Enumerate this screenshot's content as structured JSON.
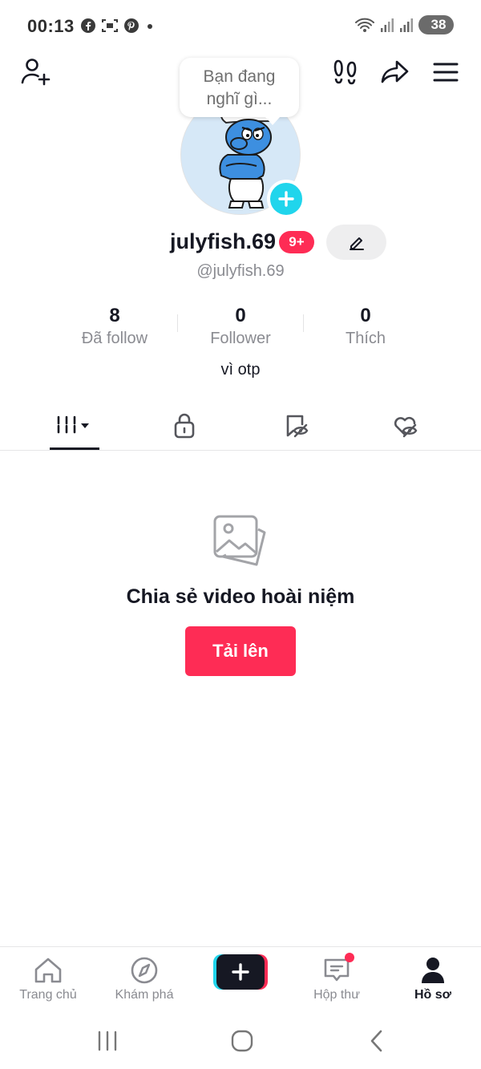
{
  "status_bar": {
    "time": "00:13",
    "app_icons": [
      "facebook-icon",
      "screenshot-icon",
      "pinterest-icon",
      "dot-icon"
    ],
    "battery": "38"
  },
  "header": {
    "add_friend_icon": "person-add-icon",
    "footprints_icon": "footprints-icon",
    "share_icon": "share-arrow-icon",
    "menu_icon": "hamburger-menu-icon"
  },
  "profile": {
    "bubble_text_line1": "Bạn đang",
    "bubble_text_line2": "nghĩ gì...",
    "username": "julyfish.69",
    "notification_badge": "9+",
    "handle": "@julyfish.69",
    "bio": "vì otp"
  },
  "stats": [
    {
      "value": "8",
      "label": "Đã follow"
    },
    {
      "value": "0",
      "label": "Follower"
    },
    {
      "value": "0",
      "label": "Thích"
    }
  ],
  "tabs": [
    "videos-grid-icon",
    "lock-icon",
    "bookmark-hidden-icon",
    "heart-hidden-icon"
  ],
  "empty_state": {
    "title": "Chia sẻ video hoài niệm",
    "button": "Tải lên"
  },
  "bottom_nav": [
    {
      "label": "Trang chủ",
      "icon": "home-icon"
    },
    {
      "label": "Khám phá",
      "icon": "compass-icon"
    },
    {
      "label": "",
      "icon": "plus-icon"
    },
    {
      "label": "Hộp thư",
      "icon": "inbox-icon"
    },
    {
      "label": "Hồ sơ",
      "icon": "profile-icon"
    }
  ],
  "colors": {
    "accent": "#fe2c55",
    "cyan": "#20d5ec",
    "text": "#161823",
    "muted": "#8a8b91"
  }
}
